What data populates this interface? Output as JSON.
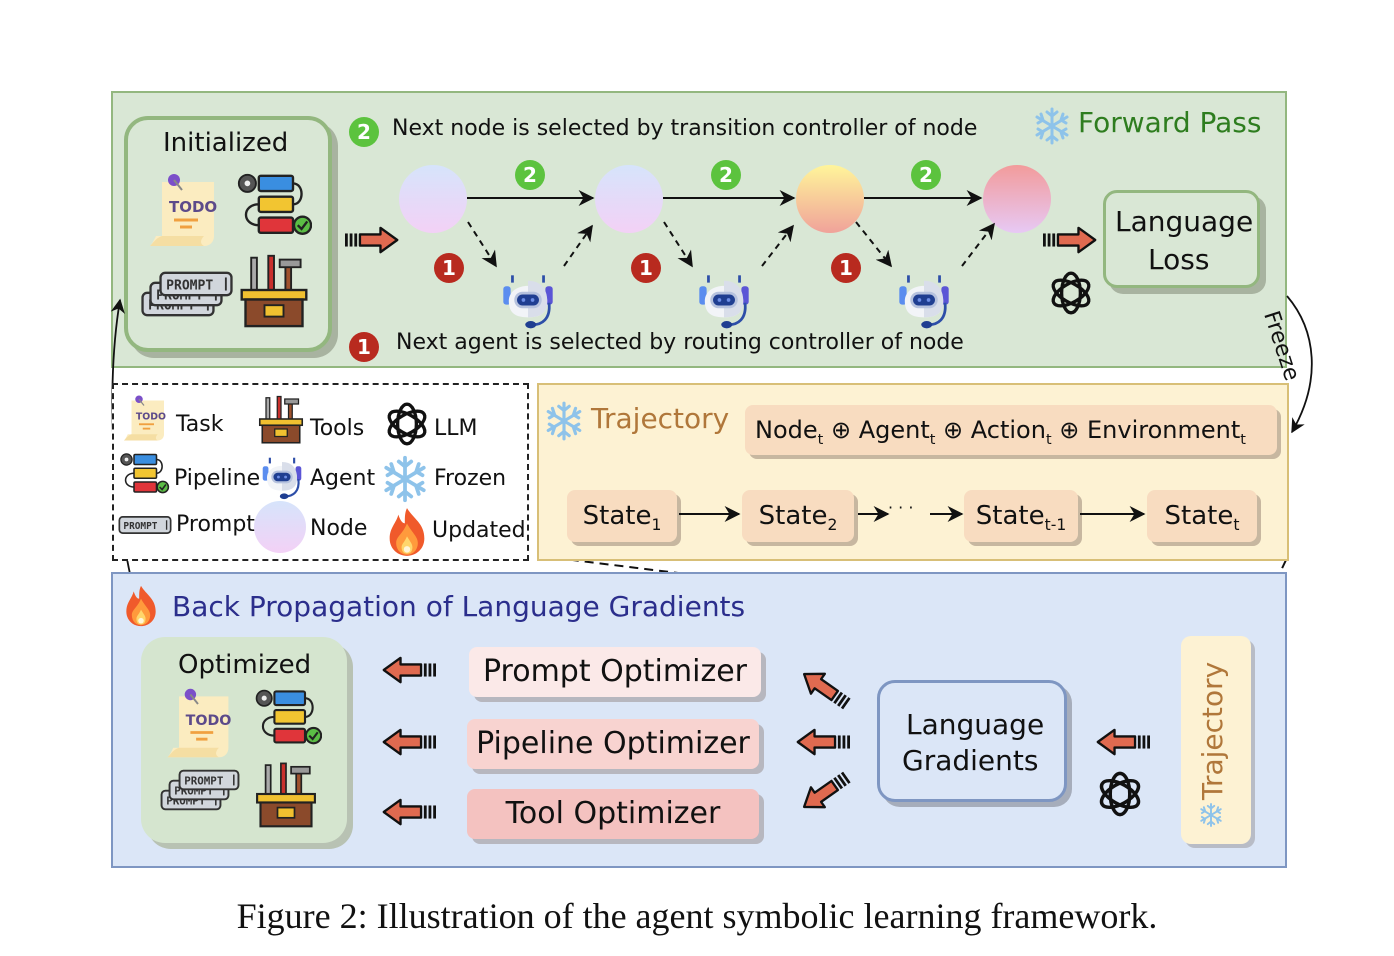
{
  "forward_pass": {
    "title": "Forward Pass",
    "initialized_label": "Initialized",
    "transition_note_badge": "2",
    "transition_note": "Next node is selected by transition controller of node",
    "routing_note_badge": "1",
    "routing_note": "Next agent is selected by routing controller of node",
    "transition_badges": [
      "2",
      "2",
      "2"
    ],
    "routing_badges": [
      "1",
      "1",
      "1"
    ],
    "loss_box": [
      "Language",
      "Loss"
    ],
    "todo_text": "TO DO",
    "prompt_text": "PROMPT"
  },
  "freeze_label": "Freeze",
  "legend": {
    "items": [
      {
        "icon": "todo-note-icon",
        "label": "Task"
      },
      {
        "icon": "toolbox-icon",
        "label": "Tools"
      },
      {
        "icon": "llm-openai-icon",
        "label": "LLM"
      },
      {
        "icon": "pipeline-icon",
        "label": "Pipeline"
      },
      {
        "icon": "robot-agent-icon",
        "label": "Agent"
      },
      {
        "icon": "snowflake-icon",
        "label": "Frozen"
      },
      {
        "icon": "prompt-card-icon",
        "label": "Prompt"
      },
      {
        "icon": "node-circle-icon",
        "label": "Node"
      },
      {
        "icon": "fire-icon",
        "label": "Updated"
      }
    ]
  },
  "trajectory": {
    "title": "Trajectory",
    "formula": {
      "node": "Node",
      "agent": "Agent",
      "action": "Action",
      "env": "Environment",
      "sub": "t",
      "op": "⊕"
    },
    "states": [
      {
        "base": "State",
        "sub": "1"
      },
      {
        "base": "State",
        "sub": "2"
      },
      {
        "base": "State",
        "sub": "t-1"
      },
      {
        "base": "State",
        "sub": "t"
      }
    ],
    "ellipsis": "· · ·"
  },
  "backprop": {
    "title": "Back Propagation of Language Gradients",
    "optimized_label": "Optimized",
    "optimizers": [
      "Prompt Optimizer",
      "Pipeline Optimizer",
      "Tool Optimizer"
    ],
    "gradients_box": [
      "Language",
      "Gradients"
    ],
    "trajectory_tag": "Trajectory"
  },
  "caption": "Figure 2: Illustration of the agent symbolic learning framework.",
  "colors": {
    "forward_bg": "#d9e7d5",
    "backward_bg": "#dbe6f7",
    "trajectory_bg": "#fdf2d3",
    "arrow_fill": "#e06a50",
    "badge_green": "#5cc33e",
    "badge_red": "#b82a1f"
  }
}
